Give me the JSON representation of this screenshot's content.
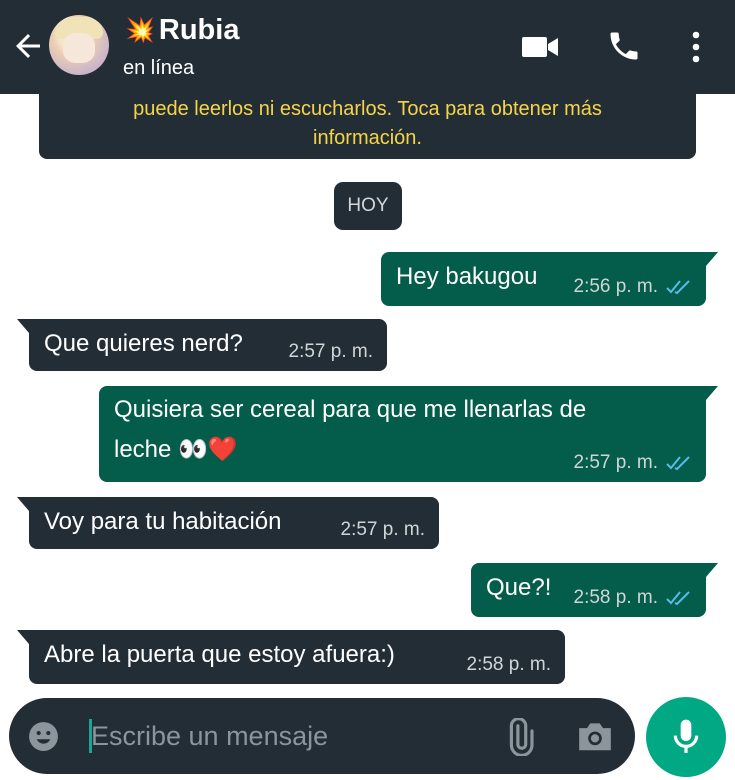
{
  "header": {
    "title": "Rubia",
    "title_prefix_emoji": "💥",
    "status": "en línea",
    "icons": [
      "back-arrow-icon",
      "video-call-icon",
      "phone-icon",
      "more-vert-icon"
    ]
  },
  "notice": {
    "line1": "puede leerlos ni escucharlos. Toca para obtener más",
    "line2": "información."
  },
  "date_badge": "HOY",
  "messages": [
    {
      "dir": "out",
      "text": "Hey bakugou",
      "time": "2:56 p. m.",
      "read": true
    },
    {
      "dir": "in",
      "text": "Que quieres nerd?",
      "time": "2:57 p. m."
    },
    {
      "dir": "out",
      "text_line1": "Quisiera ser cereal para que me llenarlas de",
      "text_line2": "leche 👀❤️",
      "time": "2:57 p. m.",
      "read": true
    },
    {
      "dir": "in",
      "text": "Voy para tu habitación",
      "time": "2:57 p. m."
    },
    {
      "dir": "out",
      "text": "Que?!",
      "time": "2:58 p. m.",
      "read": true
    },
    {
      "dir": "in",
      "text": "Abre la puerta que estoy afuera:)",
      "time": "2:58 p. m."
    }
  ],
  "composer": {
    "placeholder": "Escribe un mensaje",
    "icons": [
      "emoji-icon",
      "attach-icon",
      "camera-icon",
      "mic-icon"
    ]
  },
  "colors": {
    "header_bg": "#232d36",
    "outgoing_bubble": "#045c4a",
    "incoming_bubble": "#232d36",
    "notice_text": "#f5d547",
    "read_ticks": "#53bdeb",
    "mic_button": "#00a884"
  }
}
